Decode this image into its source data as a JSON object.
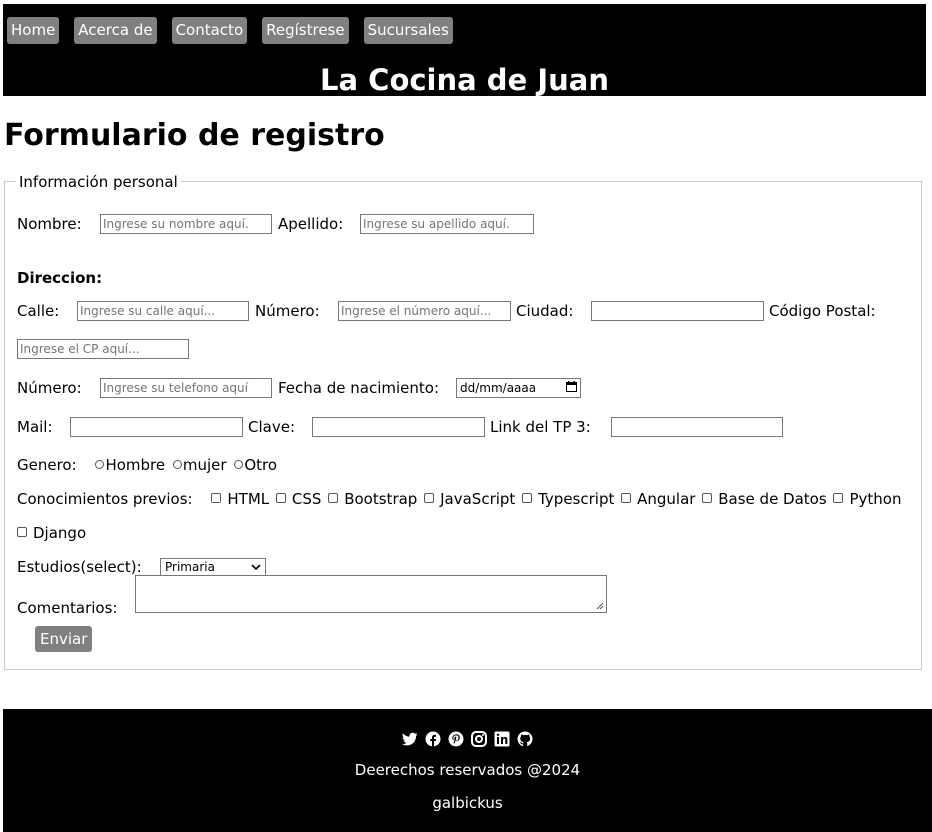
{
  "header": {
    "nav": [
      "Home",
      "Acerca de",
      "Contacto",
      "Regístrese",
      "Sucursales"
    ],
    "site_title": "La Cocina de Juan"
  },
  "form": {
    "title": "Formulario de registro",
    "legend": "Información personal",
    "nombre_label": "Nombre:",
    "nombre_placeholder": "Ingrese su nombre aquí.",
    "apellido_label": "Apellido:",
    "apellido_placeholder": "Ingrese su apellido aquí.",
    "direccion_heading": "Direccion:",
    "calle_label": "Calle:",
    "calle_placeholder": "Ingrese su calle aquí...",
    "numero_label": "Número:",
    "numero_placeholder": "Ingrese el número aquí...",
    "ciudad_label": "Ciudad:",
    "cp_label": "Código Postal:",
    "cp_placeholder": "Ingrese el CP aquí...",
    "telefono_label": "Número:",
    "telefono_placeholder": "Ingrese su telefono aquí",
    "fecha_label": "Fecha de nacimiento:",
    "fecha_value": "dd/mm/aaaa",
    "mail_label": "Mail:",
    "clave_label": "Clave:",
    "link_label": "Link del TP 3:",
    "genero_label": "Genero:",
    "genero_options": [
      "Hombre",
      "mujer",
      "Otro"
    ],
    "conocimientos_label": "Conocimientos previos:",
    "conocimientos": [
      "HTML",
      "CSS",
      "Bootstrap",
      "JavaScript",
      "Typescript",
      "Angular",
      "Base de Datos",
      "Python",
      "Django"
    ],
    "estudios_label": "Estudios(select):",
    "estudios_value": "Primaria",
    "comentarios_label": "Comentarios:",
    "submit": "Enviar"
  },
  "footer": {
    "social_icons": [
      "twitter-icon",
      "facebook-icon",
      "pinterest-icon",
      "instagram-icon",
      "linkedin-icon",
      "github-icon"
    ],
    "rights": "Deerechos reservados @2024",
    "author": "galbickus"
  }
}
